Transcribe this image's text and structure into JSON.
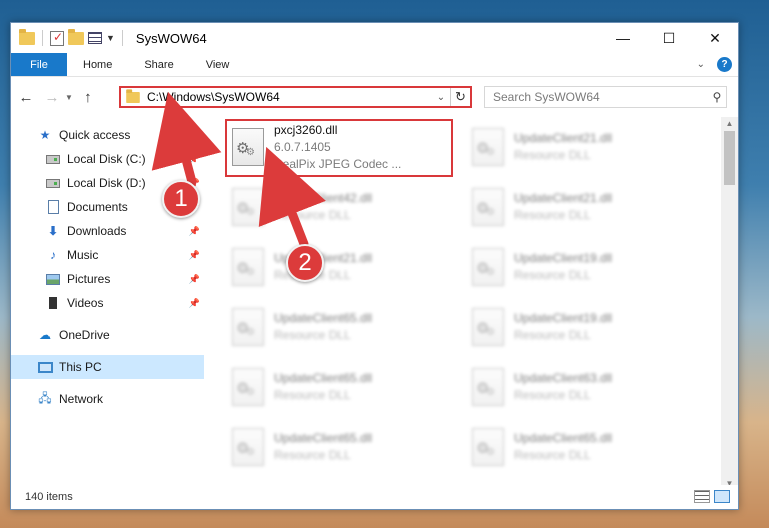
{
  "window": {
    "title": "SysWOW64",
    "controls": {
      "minimize": "—",
      "maximize": "☐",
      "close": "✕"
    }
  },
  "ribbon": {
    "file_tab": "File",
    "tabs": [
      "Home",
      "Share",
      "View"
    ],
    "expand_glyph": "⌄",
    "help_glyph": "?"
  },
  "address": {
    "path": "C:\\Windows\\SysWOW64",
    "search_placeholder": "Search SysWOW64"
  },
  "nav": {
    "quick_access": "Quick access",
    "quick_items": [
      {
        "label": "Local Disk (C:)",
        "icon": "disk-icon"
      },
      {
        "label": "Local Disk (D:)",
        "icon": "disk-icon"
      },
      {
        "label": "Documents",
        "icon": "documents-icon"
      },
      {
        "label": "Downloads",
        "icon": "downloads-icon"
      },
      {
        "label": "Music",
        "icon": "music-icon"
      },
      {
        "label": "Pictures",
        "icon": "pictures-icon"
      },
      {
        "label": "Videos",
        "icon": "videos-icon"
      }
    ],
    "onedrive": "OneDrive",
    "this_pc": "This PC",
    "network": "Network"
  },
  "files": [
    {
      "name": "pxcj3260.dll",
      "line2": "6.0.7.1405",
      "line3": "RealPix JPEG Codec ..."
    },
    {
      "name": "UpdateClient21.dll",
      "line2": "Resource DLL"
    },
    {
      "name": "UpdateClient42.dll",
      "line2": "Resource DLL"
    },
    {
      "name": "UpdateClient21.dll",
      "line2": "Resource DLL"
    },
    {
      "name": "UpdateClient21.dll",
      "line2": "Resource DLL"
    },
    {
      "name": "UpdateClient19.dll",
      "line2": "Resource DLL"
    },
    {
      "name": "UpdateClient65.dll",
      "line2": "Resource DLL"
    },
    {
      "name": "UpdateClient19.dll",
      "line2": "Resource DLL"
    },
    {
      "name": "UpdateClient65.dll",
      "line2": "Resource DLL"
    },
    {
      "name": "UpdateClient63.dll",
      "line2": "Resource DLL"
    },
    {
      "name": "UpdateClient65.dll",
      "line2": "Resource DLL"
    },
    {
      "name": "UpdateClient65.dll",
      "line2": "Resource DLL"
    }
  ],
  "status": {
    "items": "140 items"
  },
  "callouts": [
    "1",
    "2"
  ],
  "colors": {
    "accent": "#1979ca",
    "highlight": "#d9383a",
    "selected": "#cce8ff"
  }
}
